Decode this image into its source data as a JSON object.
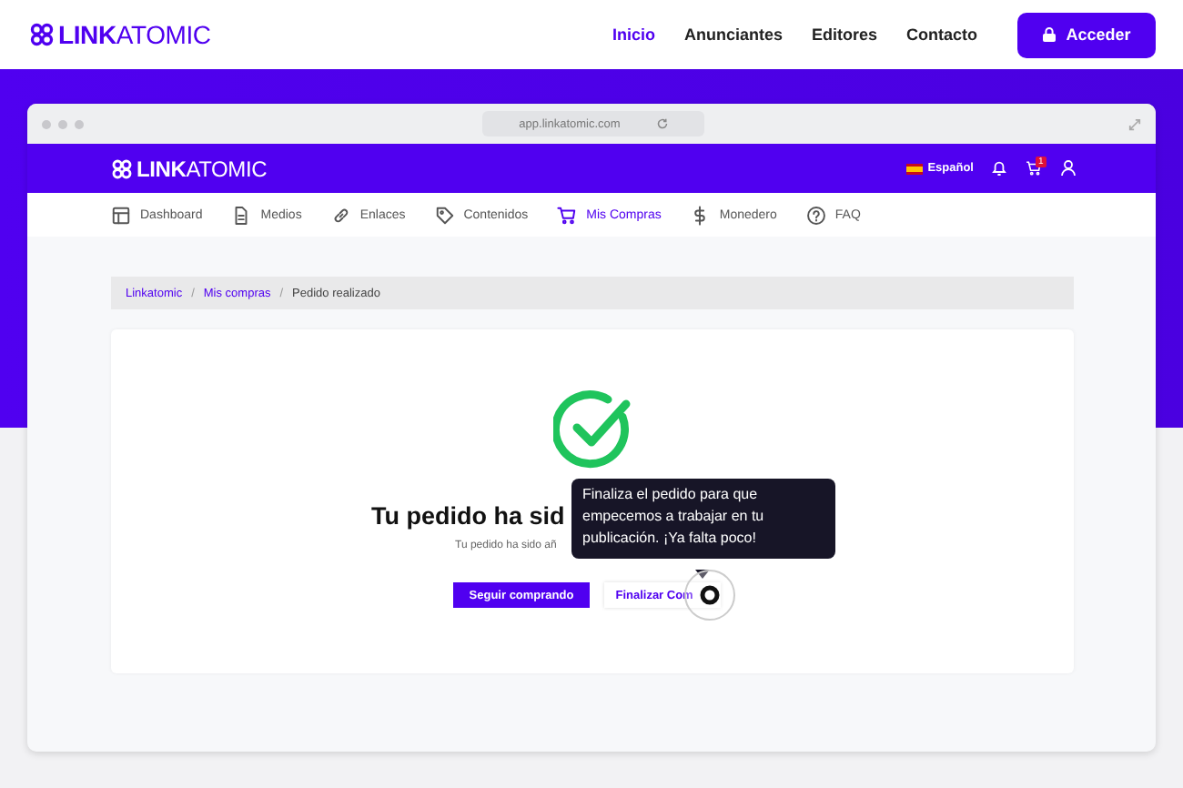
{
  "site_header": {
    "logo": "**LINK**ATOMIC",
    "nav": [
      {
        "label": "Inicio",
        "selected": true
      },
      {
        "label": "Anunciantes",
        "selected": false
      },
      {
        "label": "Editores",
        "selected": false
      },
      {
        "label": "Contacto",
        "selected": false
      }
    ],
    "login_button": "Acceder"
  },
  "browser": {
    "address": "app.linkatomic.com"
  },
  "app_header": {
    "logo": "**LINK**ATOMIC",
    "language": "Español",
    "cart_count": "1"
  },
  "app_nav": [
    {
      "label": "Dashboard",
      "selected": false
    },
    {
      "label": "Medios",
      "selected": false
    },
    {
      "label": "Enlaces",
      "selected": false
    },
    {
      "label": "Contenidos",
      "selected": false
    },
    {
      "label": "Mis Compras",
      "selected": true
    },
    {
      "label": "Monedero",
      "selected": false
    },
    {
      "label": "FAQ",
      "selected": false
    }
  ],
  "breadcrumb": [
    {
      "label": "Linkatomic",
      "kind": "link"
    },
    {
      "label": "/",
      "kind": "separator"
    },
    {
      "label": "Mis compras",
      "kind": "link"
    },
    {
      "label": "/",
      "kind": "separator"
    },
    {
      "label": "Pedido realizado",
      "kind": "current"
    }
  ],
  "confirmation": {
    "heading": "Tu pedido ha sid",
    "subtext": "Tu pedido ha sido añ",
    "buttons": [
      {
        "label": "Seguir comprando",
        "kind": "primary"
      },
      {
        "label": "Finalizar Com",
        "kind": "secondary"
      }
    ]
  },
  "tooltip": "Finaliza el pedido para que empecemos a trabajar en tu publicación. ¡Ya falta poco!"
}
